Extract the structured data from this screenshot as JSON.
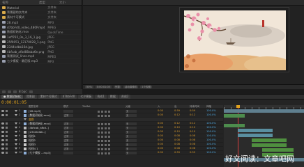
{
  "project_panel": {
    "columns": [
      "名称",
      "类型",
      "大小"
    ],
    "items": [
      {
        "name": "Material",
        "type": "文件夹",
        "size": "",
        "icon": "folder-icon",
        "color": "#d7a94a",
        "selected": false
      },
      {
        "name": "背景副的文件夹",
        "type": "文件夹",
        "size": "",
        "icon": "folder-icon",
        "color": "#d7a94a",
        "selected": false
      },
      {
        "name": "素材个可模式",
        "type": "文件夹",
        "size": "",
        "icon": "folder-icon",
        "color": "#d7a94a",
        "selected": false
      },
      {
        "name": "28.mp3",
        "type": "MP3",
        "size": "",
        "icon": "audio-file-icon",
        "color": "#9aa0b0",
        "selected": false
      },
      {
        "name": "d7bbFd0_video_480P.mp4",
        "type": "MPEG",
        "size": "",
        "icon": "video-file-icon",
        "color": "#9aa0b0",
        "selected": false
      },
      {
        "name": "数据初始化.mov",
        "type": "QuickTime",
        "size": "",
        "icon": "video-file-icon",
        "color": "#9aa0b0",
        "selected": false
      },
      {
        "name": "1eff765_0e_3_16_1.jpg",
        "type": "JPEG",
        "size": "",
        "icon": "image-file-icon",
        "color": "#b8b8b8",
        "selected": false
      },
      {
        "name": "25f0051_12170028_1.png",
        "type": "PNG",
        "size": "",
        "icon": "image-file-icon",
        "color": "#b8b8b8",
        "selected": false
      },
      {
        "name": "2344kdbb16d.jpg",
        "type": "JPEG",
        "size": "",
        "icon": "image-file-icon",
        "color": "#b8b8b8",
        "selected": false
      },
      {
        "name": "4bfcab_afbd88aba6e.png",
        "type": "PNG",
        "size": "",
        "icon": "image-file-icon",
        "color": "#b8b8b8",
        "selected": false
      },
      {
        "name": "背景测试_lines.mp4",
        "type": "MPEG",
        "size": "",
        "icon": "video-file-icon",
        "color": "#9aa0b0",
        "selected": false
      },
      {
        "name": "七夕模板 - 最后版.mp3",
        "type": "MP3",
        "size": "",
        "icon": "audio-file-icon",
        "color": "#9aa0b0",
        "selected": false
      }
    ],
    "toolbar_label": "8 bpc"
  },
  "viewer_toolbar": [
    "50%",
    "0:00:01:05",
    "完整",
    "活动摄像机",
    "1个视图"
  ],
  "tabs": [
    {
      "label": "● 数据初始化",
      "active": true
    },
    {
      "label": "背景副",
      "active": false
    },
    {
      "label": "素材个可模式",
      "active": false
    },
    {
      "label": "d7bbFd0",
      "active": false
    },
    {
      "label": "七夕模板",
      "active": false
    },
    {
      "label": "合成1",
      "active": false
    },
    {
      "label": "数据",
      "active": false
    },
    {
      "label": "合成2",
      "active": false
    }
  ],
  "timeline": {
    "timecode": "0:00:01:05",
    "header": [
      "图层名称",
      "模式",
      "TrkMat",
      "父级",
      "入",
      "出",
      "持续时间",
      "伸缩"
    ],
    "layers": [
      {
        "num": "1",
        "name": "[28.mp3]",
        "mode": "",
        "parent": "无",
        "in": "0:00",
        "out": "0:59",
        "dur": "0:59",
        "stretch": "100.0%",
        "color": "#8fb0d8",
        "selected": false,
        "sub": false
      },
      {
        "num": "2",
        "name": "[数据初始化.mov]",
        "mode": "正常",
        "parent": "无",
        "in": "0:00",
        "out": "0:12",
        "dur": "0:12",
        "stretch": "100.0%",
        "color": "#8fb0d8",
        "selected": false,
        "sub": false
      },
      {
        "num": "",
        "name": "变换",
        "mode": "",
        "parent": "",
        "in": "",
        "out": "",
        "dur": "",
        "stretch": "",
        "color": "#e0a21e",
        "selected": true,
        "sub": true
      },
      {
        "num": "3",
        "name": "[数据初始化.mov]",
        "mode": "正常",
        "parent": "无",
        "in": "0:00",
        "out": "0:12",
        "dur": "0:12",
        "stretch": "100.0%",
        "color": "#8fb0d8",
        "selected": false,
        "sub": false
      },
      {
        "num": "4",
        "name": "[4bfcab_afbd..]",
        "mode": "正常",
        "parent": "无",
        "in": "0:00",
        "out": "0:10",
        "dur": "0:10",
        "stretch": "100.0%",
        "color": "#b8b8b8",
        "selected": false,
        "sub": false
      },
      {
        "num": "5",
        "name": "[2344kdbb..]",
        "mode": "正常",
        "parent": "无",
        "in": "0:00",
        "out": "0:10",
        "dur": "0:10",
        "stretch": "100.0%",
        "color": "#b8b8b8",
        "selected": false,
        "sub": false
      },
      {
        "num": "6",
        "name": "粒线1",
        "mode": "正常",
        "parent": "无",
        "in": "0:00",
        "out": "0:08",
        "dur": "0:08",
        "stretch": "100.0%",
        "color": "#c8c8c8",
        "selected": false,
        "sub": false
      },
      {
        "num": "7",
        "name": "粒线2",
        "mode": "正常",
        "parent": "无",
        "in": "0:00",
        "out": "0:08",
        "dur": "0:08",
        "stretch": "100.0%",
        "color": "#c8c8c8",
        "selected": false,
        "sub": false
      },
      {
        "num": "8",
        "name": "粒线3",
        "mode": "正常",
        "parent": "无",
        "in": "0:00",
        "out": "0:08",
        "dur": "0:08",
        "stretch": "100.0%",
        "color": "#c8c8c8",
        "selected": false,
        "sub": false
      },
      {
        "num": "9",
        "name": "粒线4 1",
        "mode": "正常",
        "parent": "无",
        "in": "0:00",
        "out": "0:08",
        "dur": "0:08",
        "stretch": "100.0%",
        "color": "#c8c8c8",
        "selected": false,
        "sub": false
      },
      {
        "num": "10",
        "name": "[七夕模板 ...mp3]",
        "mode": "",
        "parent": "无",
        "in": "0:00",
        "out": "0:59",
        "dur": "0:59",
        "stretch": "100.0%",
        "color": "#8fb0d8",
        "selected": false,
        "sub": false
      }
    ],
    "track_colors": [
      "#5f7f8f",
      "#4d8c4d",
      "#7a6a3a",
      "#4d8c4d",
      "#5a8fa0",
      "#5a8fa0",
      "#4f8f3f",
      "#4f8f3f",
      "#4f8f3f",
      "#4f8f3f",
      "#5f7f8f"
    ]
  },
  "watermark_text": "好文阅读：文章吧网"
}
